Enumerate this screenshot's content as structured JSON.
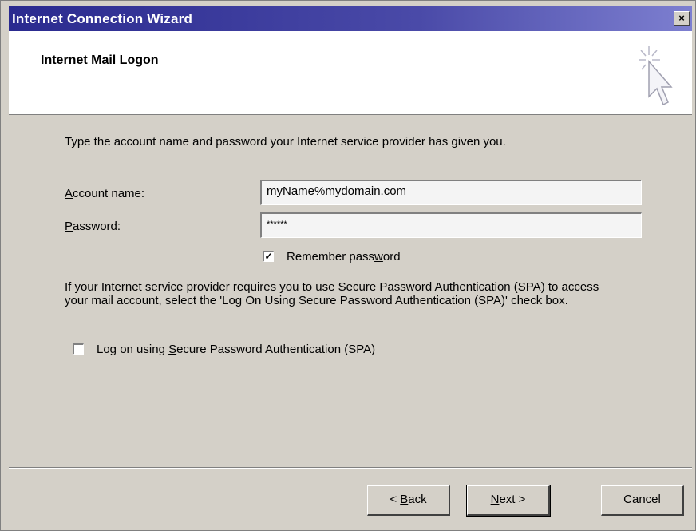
{
  "window": {
    "title": "Internet Connection Wizard",
    "close_glyph": "×"
  },
  "header": {
    "title": "Internet Mail Logon",
    "icon": "wizard-cursor-sparkle-icon"
  },
  "intro_text": "Type the account name and password your Internet service provider has given you.",
  "account": {
    "label_prefix": "A",
    "label_rest": "ccount name:",
    "value": "myName%mydomain.com"
  },
  "password": {
    "label_prefix": "P",
    "label_rest": "assword:",
    "value": "******"
  },
  "remember": {
    "label_pre": "Remember pass",
    "label_u": "w",
    "label_post": "ord",
    "checked": true
  },
  "spa_text": "If your Internet service provider requires you to use Secure Password Authentication (SPA) to access your mail account, select the 'Log On Using Secure Password Authentication (SPA)' check box.",
  "spa_check": {
    "label_pre": "Log on using ",
    "label_u": "S",
    "label_post": "ecure Password Authentication (SPA)",
    "checked": false
  },
  "buttons": {
    "back_pre": "< ",
    "back_u": "B",
    "back_post": "ack",
    "next_u": "N",
    "next_post": "ext >",
    "cancel": "Cancel"
  }
}
